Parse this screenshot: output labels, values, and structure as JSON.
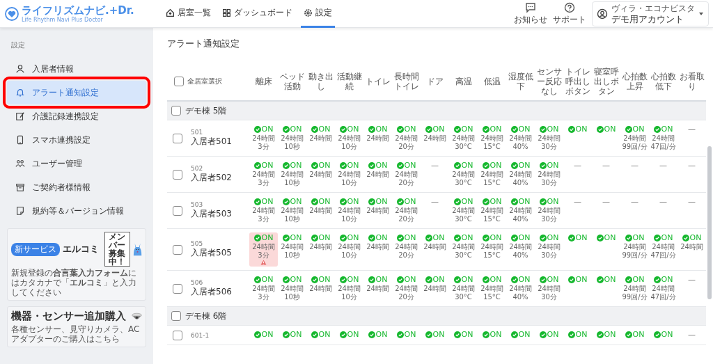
{
  "header": {
    "logo": "ライフリズムナビ.+Dr.",
    "logo_subtitle": "Life Rhythm Navi Plus Doctor",
    "tabs": [
      {
        "label": "居室一覧",
        "selected": false
      },
      {
        "label": "ダッシュボード",
        "selected": false
      },
      {
        "label": "設定",
        "selected": true
      }
    ],
    "actions": [
      {
        "label": "お知らせ"
      },
      {
        "label": "サポート"
      }
    ],
    "account": {
      "facility": "ヴィラ・エコナビスタ",
      "name": "デモ用アカウント"
    }
  },
  "sidebar": {
    "section": "設定",
    "items": [
      {
        "label": "入居者情報",
        "selected": false
      },
      {
        "label": "アラート通知設定",
        "selected": true
      },
      {
        "label": "介護記録連携設定",
        "selected": false
      },
      {
        "label": "スマホ連携設定",
        "selected": false
      },
      {
        "label": "ユーザー管理",
        "selected": false
      },
      {
        "label": "ご契約者様情報",
        "selected": false
      },
      {
        "label": "規約等＆バージョン情報",
        "selected": false
      }
    ],
    "banners": [
      {
        "kind": "service",
        "badge": "新サービス",
        "title": "エルコミ",
        "text": "新規登録の**合言葉入力フォーム**にはカタカナで「**エルコミ**」と入力してください",
        "sign": "メンバー募集中！"
      },
      {
        "kind": "shop",
        "title": "機器・センサー追加購入",
        "text": "各種センサー、見守りカメラ、ACアダプターのご購入はこちら"
      }
    ]
  },
  "page": {
    "title": "アラート通知設定",
    "table": {
      "select_all": {
        "label": "全居室選択",
        "checked": false
      },
      "columns": [
        "離床",
        "ベッド活動",
        "動き出し",
        "活動継続",
        "トイレ",
        "長時間トイレ",
        "ドア",
        "高温",
        "低温",
        "湿度低下",
        "センサー反応なし",
        "トイレ呼出しボタン",
        "寝室呼出しボタン",
        "心拍数上昇",
        "心拍数低下",
        "お看取り"
      ],
      "groups": [
        {
          "label": "デモ棟 5階",
          "checked": false,
          "rows": [
            {
              "number": "501",
              "name": "入居者501",
              "checked": false,
              "cells": [
                {
                  "kind": "on",
                  "status": "ON",
                  "lines": [
                    "24時間",
                    "3分"
                  ],
                  "alert": false
                },
                {
                  "kind": "on",
                  "status": "ON",
                  "lines": [
                    "24時間",
                    "10秒"
                  ],
                  "alert": false
                },
                {
                  "kind": "on",
                  "status": "ON",
                  "lines": [
                    "24時間"
                  ],
                  "alert": false
                },
                {
                  "kind": "on",
                  "status": "ON",
                  "lines": [
                    "24時間",
                    "10分"
                  ],
                  "alert": false
                },
                {
                  "kind": "on",
                  "status": "ON",
                  "lines": [
                    "24時間"
                  ],
                  "alert": false
                },
                {
                  "kind": "on",
                  "status": "ON",
                  "lines": [
                    "24時間",
                    "20分"
                  ],
                  "alert": false
                },
                {
                  "kind": "on",
                  "status": "ON",
                  "lines": [
                    "24時間"
                  ],
                  "alert": false
                },
                {
                  "kind": "on",
                  "status": "ON",
                  "lines": [
                    "24時間",
                    "30°C"
                  ],
                  "alert": false
                },
                {
                  "kind": "on",
                  "status": "ON",
                  "lines": [
                    "24時間",
                    "15°C"
                  ],
                  "alert": false
                },
                {
                  "kind": "on",
                  "status": "ON",
                  "lines": [
                    "24時間",
                    "40%"
                  ],
                  "alert": false
                },
                {
                  "kind": "on",
                  "status": "ON",
                  "lines": [
                    "24時間",
                    "30分"
                  ],
                  "alert": false
                },
                {
                  "kind": "on",
                  "status": "ON",
                  "alert": false
                },
                {
                  "kind": "on",
                  "status": "ON",
                  "alert": false
                },
                {
                  "kind": "on",
                  "status": "ON",
                  "lines": [
                    "24時間",
                    "99回/分"
                  ],
                  "alert": false
                },
                {
                  "kind": "on",
                  "status": "ON",
                  "lines": [
                    "24時間",
                    "47回/分"
                  ],
                  "alert": false
                },
                {
                  "kind": "none",
                  "text": "—"
                }
              ]
            },
            {
              "number": "502",
              "name": "入居者502",
              "checked": false,
              "cells": [
                {
                  "kind": "on",
                  "status": "ON",
                  "lines": [
                    "24時間",
                    "3分"
                  ],
                  "alert": false
                },
                {
                  "kind": "on",
                  "status": "ON",
                  "lines": [
                    "24時間",
                    "10秒"
                  ],
                  "alert": false
                },
                {
                  "kind": "on",
                  "status": "ON",
                  "lines": [
                    "24時間"
                  ],
                  "alert": false
                },
                {
                  "kind": "on",
                  "status": "ON",
                  "lines": [
                    "24時間",
                    "10分"
                  ],
                  "alert": false
                },
                {
                  "kind": "on",
                  "status": "ON",
                  "lines": [
                    "24時間"
                  ],
                  "alert": false
                },
                {
                  "kind": "on",
                  "status": "ON",
                  "lines": [
                    "24時間",
                    "20分"
                  ],
                  "alert": false
                },
                {
                  "kind": "none",
                  "text": "—"
                },
                {
                  "kind": "on",
                  "status": "ON",
                  "lines": [
                    "24時間",
                    "30°C"
                  ],
                  "alert": false
                },
                {
                  "kind": "on",
                  "status": "ON",
                  "lines": [
                    "24時間",
                    "15°C"
                  ],
                  "alert": false
                },
                {
                  "kind": "on",
                  "status": "ON",
                  "lines": [
                    "24時間",
                    "40%"
                  ],
                  "alert": false
                },
                {
                  "kind": "on",
                  "status": "ON",
                  "lines": [
                    "24時間",
                    "30分"
                  ],
                  "alert": false
                },
                {
                  "kind": "none",
                  "text": "—"
                },
                {
                  "kind": "none",
                  "text": "—"
                },
                {
                  "kind": "none",
                  "text": "—"
                },
                {
                  "kind": "none",
                  "text": "—"
                },
                {
                  "kind": "none",
                  "text": "—"
                }
              ]
            },
            {
              "number": "503",
              "name": "入居者503",
              "checked": false,
              "cells": [
                {
                  "kind": "on",
                  "status": "ON",
                  "lines": [
                    "24時間",
                    "3分"
                  ],
                  "alert": false
                },
                {
                  "kind": "on",
                  "status": "ON",
                  "lines": [
                    "24時間",
                    "10秒"
                  ],
                  "alert": false
                },
                {
                  "kind": "on",
                  "status": "ON",
                  "lines": [
                    "24時間"
                  ],
                  "alert": false
                },
                {
                  "kind": "on",
                  "status": "ON",
                  "lines": [
                    "24時間",
                    "10分"
                  ],
                  "alert": false
                },
                {
                  "kind": "on",
                  "status": "ON",
                  "lines": [
                    "24時間"
                  ],
                  "alert": false
                },
                {
                  "kind": "on",
                  "status": "ON",
                  "lines": [
                    "24時間",
                    "20分"
                  ],
                  "alert": false
                },
                {
                  "kind": "none",
                  "text": "—"
                },
                {
                  "kind": "on",
                  "status": "ON",
                  "lines": [
                    "24時間",
                    "30°C"
                  ],
                  "alert": false
                },
                {
                  "kind": "on",
                  "status": "ON",
                  "lines": [
                    "24時間",
                    "15°C"
                  ],
                  "alert": false
                },
                {
                  "kind": "on",
                  "status": "ON",
                  "lines": [
                    "24時間",
                    "40%"
                  ],
                  "alert": false
                },
                {
                  "kind": "on",
                  "status": "ON",
                  "lines": [
                    "24時間",
                    "30分"
                  ],
                  "alert": false
                },
                {
                  "kind": "none",
                  "text": "—"
                },
                {
                  "kind": "none",
                  "text": "—"
                },
                {
                  "kind": "none",
                  "text": "—"
                },
                {
                  "kind": "none",
                  "text": "—"
                },
                {
                  "kind": "none",
                  "text": "—"
                }
              ]
            },
            {
              "number": "505",
              "name": "入居者505",
              "checked": false,
              "cells": [
                {
                  "kind": "on",
                  "status": "ON",
                  "lines": [
                    "24時間",
                    "3分"
                  ],
                  "alert": true
                },
                {
                  "kind": "on",
                  "status": "ON",
                  "lines": [
                    "24時間",
                    "10秒"
                  ],
                  "alert": false
                },
                {
                  "kind": "on",
                  "status": "ON",
                  "lines": [
                    "24時間"
                  ],
                  "alert": false
                },
                {
                  "kind": "on",
                  "status": "ON",
                  "lines": [
                    "24時間",
                    "10分"
                  ],
                  "alert": false
                },
                {
                  "kind": "on",
                  "status": "ON",
                  "lines": [
                    "24時間"
                  ],
                  "alert": false
                },
                {
                  "kind": "on",
                  "status": "ON",
                  "lines": [
                    "24時間",
                    "20分"
                  ],
                  "alert": false
                },
                {
                  "kind": "on",
                  "status": "ON",
                  "lines": [
                    "24時間"
                  ],
                  "alert": false
                },
                {
                  "kind": "on",
                  "status": "ON",
                  "lines": [
                    "24時間",
                    "30°C"
                  ],
                  "alert": false
                },
                {
                  "kind": "on",
                  "status": "ON",
                  "lines": [
                    "24時間",
                    "15°C"
                  ],
                  "alert": false
                },
                {
                  "kind": "on",
                  "status": "ON",
                  "lines": [
                    "24時間",
                    "40%"
                  ],
                  "alert": false
                },
                {
                  "kind": "on",
                  "status": "ON",
                  "lines": [
                    "24時間",
                    "30分"
                  ],
                  "alert": false
                },
                {
                  "kind": "on",
                  "status": "ON",
                  "alert": false
                },
                {
                  "kind": "on",
                  "status": "ON",
                  "alert": false
                },
                {
                  "kind": "on",
                  "status": "ON",
                  "lines": [
                    "24時間",
                    "99回/分"
                  ],
                  "alert": false
                },
                {
                  "kind": "on",
                  "status": "ON",
                  "lines": [
                    "24時間",
                    "47回/分"
                  ],
                  "alert": false
                },
                {
                  "kind": "on",
                  "status": "ON",
                  "lines": [
                    "24時間"
                  ],
                  "alert": false
                }
              ]
            },
            {
              "number": "506",
              "name": "入居者506",
              "checked": false,
              "cells": [
                {
                  "kind": "on",
                  "status": "ON",
                  "lines": [
                    "24時間",
                    "3分"
                  ],
                  "alert": false
                },
                {
                  "kind": "on",
                  "status": "ON",
                  "lines": [
                    "24時間",
                    "10秒"
                  ],
                  "alert": false
                },
                {
                  "kind": "on",
                  "status": "ON",
                  "lines": [
                    "24時間"
                  ],
                  "alert": false
                },
                {
                  "kind": "on",
                  "status": "ON",
                  "lines": [
                    "24時間",
                    "10分"
                  ],
                  "alert": false
                },
                {
                  "kind": "on",
                  "status": "ON",
                  "lines": [
                    "24時間"
                  ],
                  "alert": false
                },
                {
                  "kind": "on",
                  "status": "ON",
                  "lines": [
                    "24時間",
                    "20分"
                  ],
                  "alert": false
                },
                {
                  "kind": "on",
                  "status": "ON",
                  "lines": [
                    "24時間"
                  ],
                  "alert": false
                },
                {
                  "kind": "on",
                  "status": "ON",
                  "lines": [
                    "24時間",
                    "30°C"
                  ],
                  "alert": false
                },
                {
                  "kind": "on",
                  "status": "ON",
                  "lines": [
                    "24時間",
                    "15°C"
                  ],
                  "alert": false
                },
                {
                  "kind": "on",
                  "status": "ON",
                  "lines": [
                    "24時間",
                    "40%"
                  ],
                  "alert": false
                },
                {
                  "kind": "on",
                  "status": "ON",
                  "lines": [
                    "24時間",
                    "30分"
                  ],
                  "alert": false
                },
                {
                  "kind": "on",
                  "status": "ON",
                  "alert": false
                },
                {
                  "kind": "on",
                  "status": "ON",
                  "alert": false
                },
                {
                  "kind": "on",
                  "status": "ON",
                  "lines": [
                    "24時間",
                    "99回/分"
                  ],
                  "alert": false
                },
                {
                  "kind": "on",
                  "status": "ON",
                  "lines": [
                    "24時間",
                    "47回/分"
                  ],
                  "alert": false
                },
                {
                  "kind": "none",
                  "text": "—"
                }
              ]
            }
          ]
        },
        {
          "label": "デモ棟 6階",
          "checked": false,
          "rows": [
            {
              "number": "601-1",
              "checked": false,
              "cells": [
                {
                  "kind": "on",
                  "status": "ON",
                  "alert": false
                },
                {
                  "kind": "on",
                  "status": "ON",
                  "alert": false
                },
                {
                  "kind": "on",
                  "status": "ON",
                  "alert": false
                },
                {
                  "kind": "on",
                  "status": "ON",
                  "alert": false
                },
                {
                  "kind": "on",
                  "status": "ON",
                  "alert": false
                },
                {
                  "kind": "on",
                  "status": "ON",
                  "alert": false
                },
                {
                  "kind": "on",
                  "status": "ON",
                  "alert": false
                },
                {
                  "kind": "on",
                  "status": "ON",
                  "alert": false
                },
                {
                  "kind": "on",
                  "status": "ON",
                  "alert": false
                },
                {
                  "kind": "on",
                  "status": "ON",
                  "alert": false
                },
                {
                  "kind": "on",
                  "status": "ON",
                  "alert": false
                },
                {
                  "kind": "on",
                  "status": "ON",
                  "alert": false
                },
                {
                  "kind": "on",
                  "status": "ON",
                  "alert": false
                },
                {
                  "kind": "on",
                  "status": "ON",
                  "alert": false
                },
                {
                  "kind": "on",
                  "status": "ON",
                  "alert": false
                },
                {
                  "kind": "none",
                  "text": "—"
                }
              ]
            }
          ]
        }
      ]
    }
  }
}
